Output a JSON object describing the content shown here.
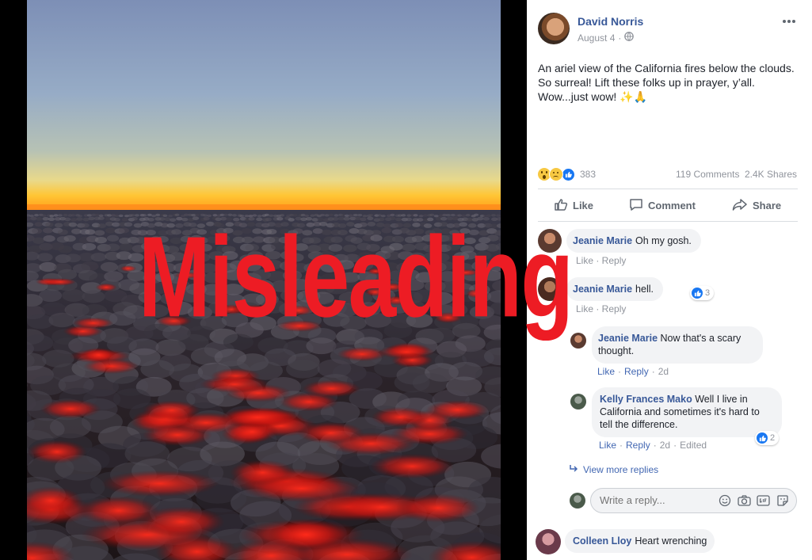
{
  "post": {
    "author": "David Norris",
    "date": "August 4",
    "date_separator": "·",
    "text_line1": "An ariel view of the California fires below the clouds.",
    "text_line2": "So surreal! Lift these folks up in prayer, y’all.",
    "text_line3": "Wow...just wow! ✨🙏",
    "reaction_count": "383",
    "comments_count": "119 Comments",
    "shares_count": "2.4K Shares",
    "menu_icon": "more-horizontal-icon"
  },
  "action_bar": {
    "like": "Like",
    "comment": "Comment",
    "share": "Share"
  },
  "comments": [
    {
      "author": "Jeanie Marie",
      "text": "Oh my gosh.",
      "actions": "Like · Reply"
    },
    {
      "author": "Jeanie Marie",
      "text": "hell.",
      "reaction_count": "3",
      "actions": "Like · Reply"
    }
  ],
  "replies": [
    {
      "author": "Jeanie Marie",
      "text_line1": "Now that's a scary",
      "text_line2": "thought.",
      "like": "Like",
      "reply": "Reply",
      "age": "2d"
    },
    {
      "author": "Kelly Frances Mako",
      "text_line1": "Well I live in",
      "text_line2": "California and sometimes it's hard to",
      "text_line3": "tell the difference.",
      "reaction_count": "2",
      "like": "Like",
      "reply": "Reply",
      "age": "2d",
      "edited": "Edited"
    }
  ],
  "view_more_replies": "View more replies",
  "reply_input": {
    "placeholder": "Write a reply..."
  },
  "last_comment": {
    "author": "Colleen Lloy",
    "text": "Heart wrenching"
  },
  "overlay": {
    "label": "Misleading",
    "color": "#ed1c24"
  },
  "colors": {
    "link": "#385898",
    "like_blue": "#1877f2"
  }
}
